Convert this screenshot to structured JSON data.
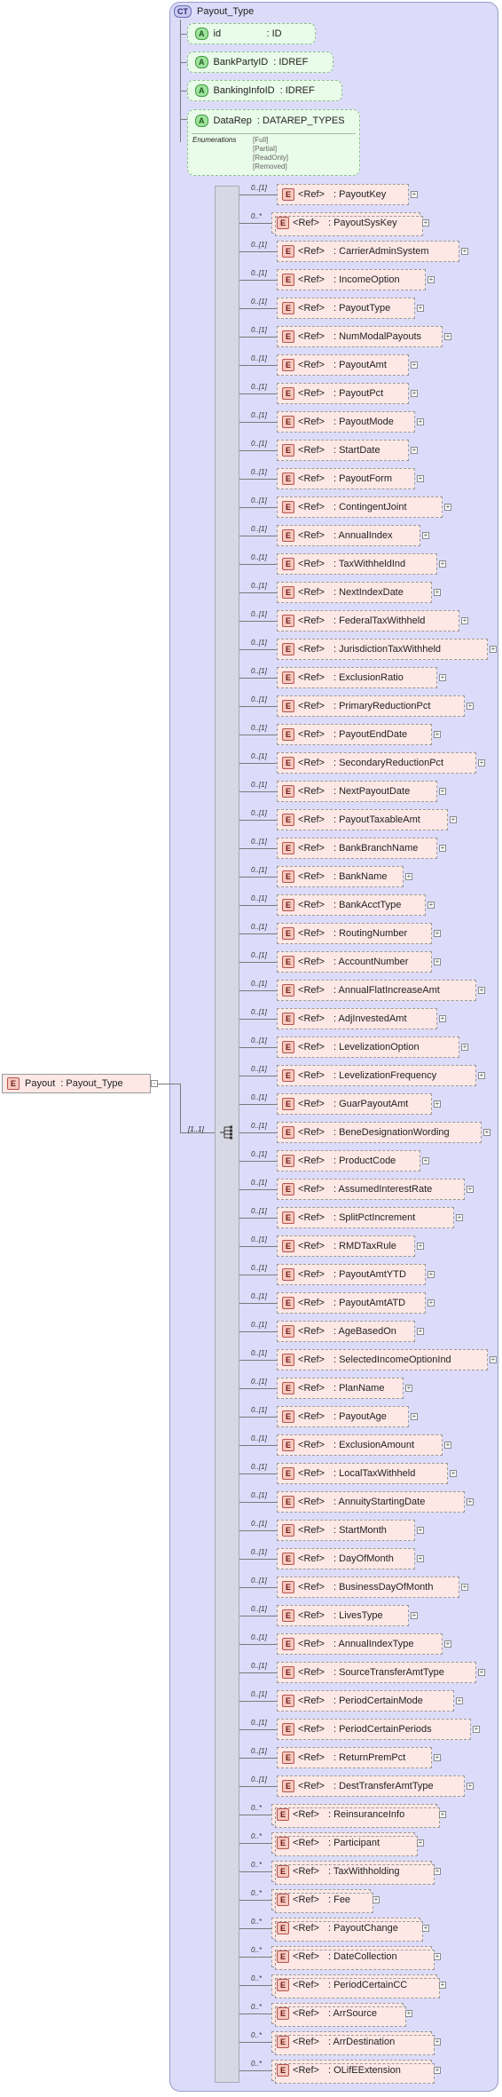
{
  "complex_type": {
    "badge": "CT",
    "name": "Payout_Type"
  },
  "attributes": [
    {
      "badge": "A",
      "name": "id",
      "type": ": ID"
    },
    {
      "badge": "A",
      "name": "BankPartyID",
      "type": ": IDREF"
    },
    {
      "badge": "A",
      "name": "BankingInfoID",
      "type": ": IDREF"
    }
  ],
  "datarep": {
    "badge": "A",
    "name": "DataRep",
    "type": ": DATAREP_TYPES",
    "enum_label": "Enumerations",
    "enums": [
      "[Full]",
      "[Partial]",
      "[ReadOnly]",
      "[Removed]"
    ]
  },
  "root": {
    "badge": "E",
    "name": "Payout",
    "type": ": Payout_Type"
  },
  "sequence_cardinality": "[1..1]",
  "ref_label": "<Ref>",
  "elements": [
    {
      "card": "0..[1]",
      "name": ": PayoutKey"
    },
    {
      "card": "0..*",
      "name": ": PayoutSysKey",
      "multi": true
    },
    {
      "card": "0..[1]",
      "name": ": CarrierAdminSystem"
    },
    {
      "card": "0..[1]",
      "name": ": IncomeOption"
    },
    {
      "card": "0..[1]",
      "name": ": PayoutType"
    },
    {
      "card": "0..[1]",
      "name": ": NumModalPayouts"
    },
    {
      "card": "0..[1]",
      "name": ": PayoutAmt"
    },
    {
      "card": "0..[1]",
      "name": ": PayoutPct"
    },
    {
      "card": "0..[1]",
      "name": ": PayoutMode"
    },
    {
      "card": "0..[1]",
      "name": ": StartDate"
    },
    {
      "card": "0..[1]",
      "name": ": PayoutForm"
    },
    {
      "card": "0..[1]",
      "name": ": ContingentJoint"
    },
    {
      "card": "0..[1]",
      "name": ": AnnualIndex"
    },
    {
      "card": "0..[1]",
      "name": ": TaxWithheldInd"
    },
    {
      "card": "0..[1]",
      "name": ": NextIndexDate"
    },
    {
      "card": "0..[1]",
      "name": ": FederalTaxWithheld"
    },
    {
      "card": "0..[1]",
      "name": ": JurisdictionTaxWithheld"
    },
    {
      "card": "0..[1]",
      "name": ": ExclusionRatio"
    },
    {
      "card": "0..[1]",
      "name": ": PrimaryReductionPct"
    },
    {
      "card": "0..[1]",
      "name": ": PayoutEndDate"
    },
    {
      "card": "0..[1]",
      "name": ": SecondaryReductionPct"
    },
    {
      "card": "0..[1]",
      "name": ": NextPayoutDate"
    },
    {
      "card": "0..[1]",
      "name": ": PayoutTaxableAmt"
    },
    {
      "card": "0..[1]",
      "name": ": BankBranchName"
    },
    {
      "card": "0..[1]",
      "name": ": BankName"
    },
    {
      "card": "0..[1]",
      "name": ": BankAcctType"
    },
    {
      "card": "0..[1]",
      "name": ": RoutingNumber"
    },
    {
      "card": "0..[1]",
      "name": ": AccountNumber"
    },
    {
      "card": "0..[1]",
      "name": ": AnnualFlatIncreaseAmt"
    },
    {
      "card": "0..[1]",
      "name": ": AdjInvestedAmt"
    },
    {
      "card": "0..[1]",
      "name": ": LevelizationOption"
    },
    {
      "card": "0..[1]",
      "name": ": LevelizationFrequency"
    },
    {
      "card": "0..[1]",
      "name": ": GuarPayoutAmt"
    },
    {
      "card": "0..[1]",
      "name": ": BeneDesignationWording"
    },
    {
      "card": "0..[1]",
      "name": ": ProductCode"
    },
    {
      "card": "0..[1]",
      "name": ": AssumedInterestRate"
    },
    {
      "card": "0..[1]",
      "name": ": SplitPctIncrement"
    },
    {
      "card": "0..[1]",
      "name": ": RMDTaxRule"
    },
    {
      "card": "0..[1]",
      "name": ": PayoutAmtYTD"
    },
    {
      "card": "0..[1]",
      "name": ": PayoutAmtATD"
    },
    {
      "card": "0..[1]",
      "name": ": AgeBasedOn"
    },
    {
      "card": "0..[1]",
      "name": ": SelectedIncomeOptionInd"
    },
    {
      "card": "0..[1]",
      "name": ": PlanName"
    },
    {
      "card": "0..[1]",
      "name": ": PayoutAge"
    },
    {
      "card": "0..[1]",
      "name": ": ExclusionAmount"
    },
    {
      "card": "0..[1]",
      "name": ": LocalTaxWithheld"
    },
    {
      "card": "0..[1]",
      "name": ": AnnuityStartingDate"
    },
    {
      "card": "0..[1]",
      "name": ": StartMonth"
    },
    {
      "card": "0..[1]",
      "name": ": DayOfMonth"
    },
    {
      "card": "0..[1]",
      "name": ": BusinessDayOfMonth"
    },
    {
      "card": "0..[1]",
      "name": ": LivesType"
    },
    {
      "card": "0..[1]",
      "name": ": AnnualIndexType"
    },
    {
      "card": "0..[1]",
      "name": ": SourceTransferAmtType"
    },
    {
      "card": "0..[1]",
      "name": ": PeriodCertainMode"
    },
    {
      "card": "0..[1]",
      "name": ": PeriodCertainPeriods"
    },
    {
      "card": "0..[1]",
      "name": ": ReturnPremPct"
    },
    {
      "card": "0..[1]",
      "name": ": DestTransferAmtType"
    },
    {
      "card": "0..*",
      "name": ": ReinsuranceInfo",
      "multi": true
    },
    {
      "card": "0..*",
      "name": ": Participant",
      "multi": true
    },
    {
      "card": "0..*",
      "name": ": TaxWithholding",
      "multi": true
    },
    {
      "card": "0..*",
      "name": ": Fee",
      "multi": true
    },
    {
      "card": "0..*",
      "name": ": PayoutChange",
      "multi": true
    },
    {
      "card": "0..*",
      "name": ": DateCollection",
      "multi": true
    },
    {
      "card": "0..*",
      "name": ": PeriodCertainCC",
      "multi": true
    },
    {
      "card": "0..*",
      "name": ": ArrSource",
      "multi": true
    },
    {
      "card": "0..*",
      "name": ": ArrDestination",
      "multi": true
    },
    {
      "card": "0..*",
      "name": ": OLifEExtension",
      "multi": true
    }
  ]
}
